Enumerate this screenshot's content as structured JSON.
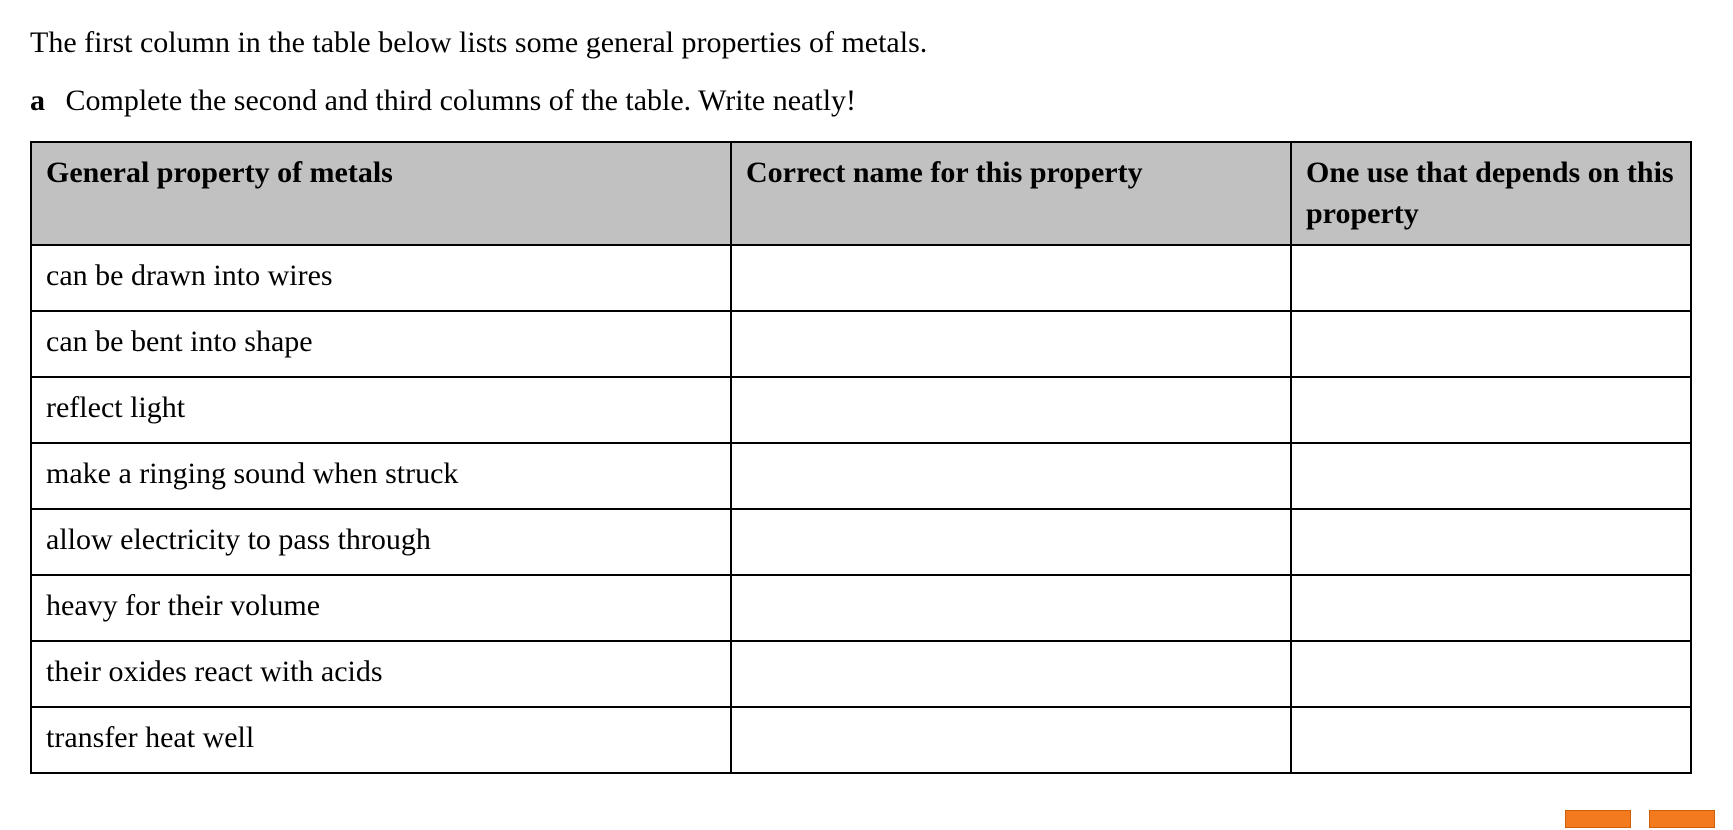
{
  "intro_text": "The first column in the table below lists some general properties of metals.",
  "part": {
    "label": "a",
    "text": "Complete the second and third columns of the table. Write neatly!"
  },
  "table": {
    "headers": {
      "col1": "General property of metals",
      "col2": "Correct name for this property",
      "col3": "One use that depends on this property"
    },
    "rows": [
      {
        "property": "can be drawn into wires",
        "name": "",
        "use": ""
      },
      {
        "property": "can be bent into shape",
        "name": "",
        "use": ""
      },
      {
        "property": "reflect light",
        "name": "",
        "use": ""
      },
      {
        "property": "make a ringing sound when struck",
        "name": "",
        "use": ""
      },
      {
        "property": "allow electricity to pass through",
        "name": "",
        "use": ""
      },
      {
        "property": "heavy for their volume",
        "name": "",
        "use": ""
      },
      {
        "property": "their oxides react with acids",
        "name": "",
        "use": ""
      },
      {
        "property": "transfer heat well",
        "name": "",
        "use": ""
      }
    ]
  }
}
